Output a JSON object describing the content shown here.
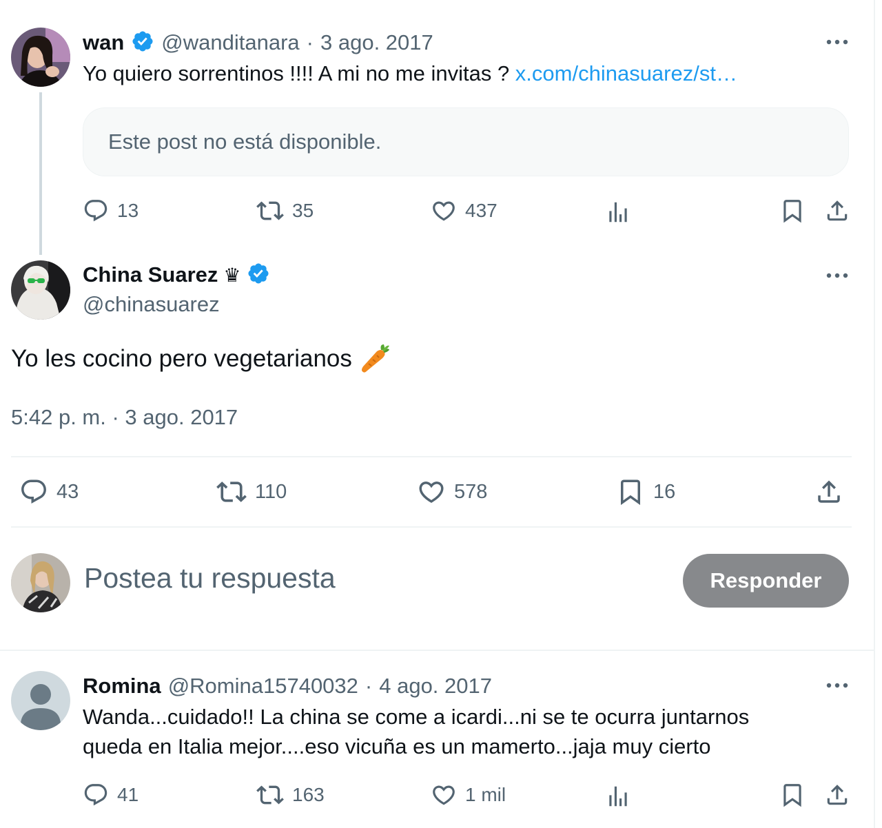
{
  "thread": {
    "parent": {
      "name": "wan",
      "handle": "@wanditanara",
      "separator": "·",
      "date": "3 ago. 2017",
      "text": "Yo quiero sorrentinos !!!! A mi no me invitas ? ",
      "link": "x.com/chinasuarez/st…",
      "quote_unavailable": "Este post no está disponible.",
      "replies": "13",
      "reposts": "35",
      "likes": "437"
    },
    "main": {
      "name": "China Suarez",
      "crown": "♛",
      "handle": "@chinasuarez",
      "text": "Yo les cocino pero vegetarianos",
      "emoji": "🥕",
      "time": "5:42 p. m. · 3 ago. 2017",
      "replies": "43",
      "reposts": "110",
      "likes": "578",
      "bookmarks": "16"
    },
    "compose": {
      "placeholder": "Postea tu respuesta",
      "button": "Responder"
    },
    "reply": {
      "name": "Romina",
      "handle": "@Romina15740032",
      "separator": "·",
      "date": "4 ago. 2017",
      "text_line1": "Wanda...cuidado!! La china se come a icardi...ni se te ocurra juntarnos",
      "text_line2": "queda en Italia mejor....eso vicuña es un mamerto...jaja muy cierto",
      "replies": "41",
      "reposts": "163",
      "likes": "1 mil"
    }
  },
  "icons": {
    "verified": "verified-badge-icon",
    "more": "more-icon",
    "reply": "reply-icon",
    "repost": "repost-icon",
    "like": "like-icon",
    "views": "views-icon",
    "bookmark": "bookmark-icon",
    "share": "share-icon"
  },
  "colors": {
    "accent": "#1d9bf0",
    "muted": "#536471",
    "button_disabled": "#87898c"
  }
}
